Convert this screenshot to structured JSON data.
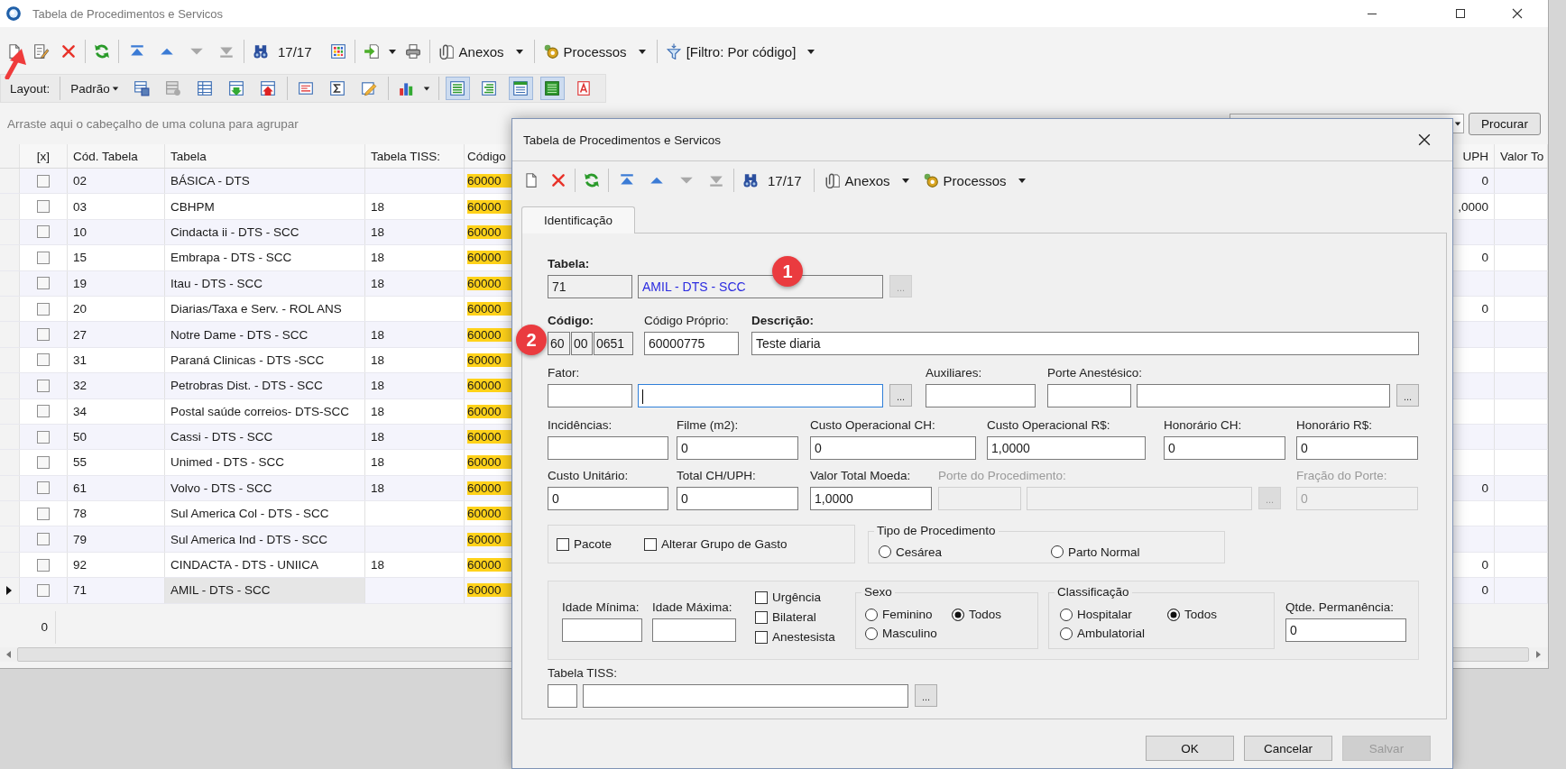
{
  "window": {
    "title": "Tabela de Procedimentos e Servicos"
  },
  "toolbar": {
    "nav": [
      {
        "disabled": false
      },
      {
        "disabled": false
      },
      {
        "disabled": true
      },
      {
        "disabled": true
      }
    ],
    "record_counter": "17/17",
    "attachments": "Anexos",
    "processes": "Processos",
    "filter": "[Filtro: Por código]"
  },
  "layout_bar": {
    "label": "Layout:",
    "preset": "Padrão",
    "views": [
      {
        "selected": true
      },
      {
        "selected": false
      },
      {
        "selected": true
      },
      {
        "selected": true
      },
      {
        "selected": false
      }
    ]
  },
  "group_panel": {
    "hint": "Arraste aqui o cabeçalho de uma coluna para agrupar",
    "search_button": "Procurar"
  },
  "grid": {
    "columns": [
      "[x]",
      "Cód. Tabela",
      "Tabela",
      "Tabela TISS:",
      "Código",
      "UPH",
      "Valor To"
    ],
    "rows": [
      {
        "checked": false,
        "selected": false,
        "code": "02",
        "table": "BÁSICA - DTS",
        "codigo": "60000",
        "uph": "0"
      },
      {
        "checked": false,
        "selected": false,
        "code": "03",
        "table": "CBHPM",
        "tiss": "18",
        "codigo": "60000",
        "uph": ",0000"
      },
      {
        "checked": false,
        "selected": false,
        "code": "10",
        "table": "Cindacta ii - DTS - SCC",
        "tiss": "18",
        "codigo": "60000"
      },
      {
        "checked": false,
        "selected": false,
        "code": "15",
        "table": "Embrapa - DTS - SCC",
        "tiss": "18",
        "codigo": "60000",
        "uph": "0"
      },
      {
        "checked": false,
        "selected": false,
        "code": "19",
        "table": "Itau - DTS - SCC",
        "tiss": "18",
        "codigo": "60000"
      },
      {
        "checked": false,
        "selected": false,
        "code": "20",
        "table": "Diarias/Taxa e Serv. - ROL ANS",
        "codigo": "60000",
        "uph": "0"
      },
      {
        "checked": false,
        "selected": false,
        "code": "27",
        "table": "Notre Dame - DTS - SCC",
        "tiss": "18",
        "codigo": "60000"
      },
      {
        "checked": false,
        "selected": false,
        "code": "31",
        "table": "Paraná Clinicas - DTS -SCC",
        "tiss": "18",
        "codigo": "60000"
      },
      {
        "checked": false,
        "selected": false,
        "code": "32",
        "table": "Petrobras Dist. - DTS - SCC",
        "tiss": "18",
        "codigo": "60000"
      },
      {
        "checked": false,
        "selected": false,
        "code": "34",
        "table": "Postal saúde correios- DTS-SCC",
        "tiss": "18",
        "codigo": "60000"
      },
      {
        "checked": false,
        "selected": false,
        "code": "50",
        "table": "Cassi - DTS - SCC",
        "tiss": "18",
        "codigo": "60000"
      },
      {
        "checked": false,
        "selected": false,
        "code": "55",
        "table": "Unimed - DTS - SCC",
        "tiss": "18",
        "codigo": "60000"
      },
      {
        "checked": false,
        "selected": false,
        "code": "61",
        "table": "Volvo - DTS - SCC",
        "tiss": "18",
        "codigo": "60000",
        "uph": "0"
      },
      {
        "checked": false,
        "selected": false,
        "code": "78",
        "table": "Sul America Col - DTS - SCC",
        "codigo": "60000"
      },
      {
        "checked": false,
        "selected": false,
        "code": "79",
        "table": "Sul America Ind - DTS - SCC",
        "codigo": "60000"
      },
      {
        "checked": false,
        "selected": false,
        "code": "92",
        "table": "CINDACTA - DTS - UNIICA",
        "tiss": "18",
        "codigo": "60000",
        "uph": "0"
      },
      {
        "checked": false,
        "selected": true,
        "code": "71",
        "table": "AMIL - DTS - SCC",
        "codigo": "60000",
        "uph": "0"
      }
    ],
    "footer": "0"
  },
  "dialog": {
    "title": "Tabela de Procedimentos e Servicos",
    "toolbar": {
      "nav": [
        {
          "disabled": false
        },
        {
          "disabled": false
        },
        {
          "disabled": true
        },
        {
          "disabled": true
        }
      ],
      "record_counter": "17/17",
      "attachments": "Anexos",
      "processes": "Processos"
    },
    "tabs": [
      {
        "label": "Identificação",
        "selected": true
      }
    ],
    "fields": [
      {
        "kind": "lookup",
        "label": "Tabela:",
        "required": true,
        "readonly": true,
        "disabled": false,
        "focused": false,
        "code": "71",
        "name": "AMIL - DTS - SCC",
        "button": "..."
      },
      {
        "kind": "segments",
        "label": "Código:",
        "required": true,
        "readonly": true,
        "disabled": false,
        "focused": false,
        "values": [
          "60",
          "00",
          "0651"
        ]
      },
      {
        "kind": "field",
        "label": "Código Próprio:",
        "required": false,
        "readonly": false,
        "disabled": false,
        "focused": false,
        "value": "60000775"
      },
      {
        "kind": "field",
        "label": "Descrição:",
        "required": true,
        "readonly": false,
        "disabled": false,
        "focused": false,
        "value": "Teste diaria"
      },
      {
        "kind": "lookup",
        "label": "Fator:",
        "required": false,
        "readonly": false,
        "disabled": false,
        "focused": true,
        "button": "..."
      },
      {
        "kind": "field",
        "label": "Auxiliares:",
        "required": false,
        "readonly": false,
        "disabled": false,
        "focused": false
      },
      {
        "kind": "lookup",
        "label": "Porte Anestésico:",
        "required": false,
        "readonly": false,
        "disabled": false,
        "focused": false,
        "button": "..."
      },
      {
        "kind": "field",
        "label": "Incidências:",
        "required": false,
        "readonly": false,
        "disabled": false,
        "focused": false
      },
      {
        "kind": "field",
        "label": "Filme (m2):",
        "required": false,
        "readonly": false,
        "disabled": false,
        "focused": false,
        "value": "0"
      },
      {
        "kind": "field",
        "label": "Custo Operacional CH:",
        "required": false,
        "readonly": false,
        "disabled": false,
        "focused": false,
        "value": "0"
      },
      {
        "kind": "field",
        "label": "Custo Operacional R$:",
        "required": false,
        "readonly": false,
        "disabled": false,
        "focused": false,
        "value": "1,0000"
      },
      {
        "kind": "field",
        "label": "Honorário CH:",
        "required": false,
        "readonly": false,
        "disabled": false,
        "focused": false,
        "value": "0"
      },
      {
        "kind": "field",
        "label": "Honorário R$:",
        "required": false,
        "readonly": false,
        "disabled": false,
        "focused": false,
        "value": "0"
      },
      {
        "kind": "field",
        "label": "Custo Unitário:",
        "required": false,
        "readonly": false,
        "disabled": false,
        "focused": false,
        "value": "0"
      },
      {
        "kind": "field",
        "label": "Total CH/UPH:",
        "required": false,
        "readonly": false,
        "disabled": false,
        "focused": false,
        "value": "0"
      },
      {
        "kind": "field",
        "label": "Valor Total Moeda:",
        "required": false,
        "readonly": false,
        "disabled": false,
        "focused": false,
        "value": "1,0000"
      },
      {
        "kind": "lookup",
        "label": "Porte do Procedimento:",
        "required": false,
        "readonly": false,
        "disabled": true,
        "focused": false,
        "button": "..."
      },
      {
        "kind": "field",
        "label": "Fração do Porte:",
        "required": false,
        "readonly": false,
        "disabled": true,
        "focused": false,
        "value": "0"
      }
    ],
    "options": {
      "checkboxes": [
        {
          "label": "Pacote",
          "checked": false
        },
        {
          "label": "Alterar Grupo de Gasto",
          "checked": false
        }
      ],
      "procedure_type": {
        "legend": "Tipo de Procedimento",
        "options": [
          {
            "label": "Cesárea",
            "selected": false
          },
          {
            "label": "Parto Normal",
            "selected": false
          }
        ]
      }
    },
    "limits": {
      "min_age": {
        "label": "Idade Mínima:"
      },
      "max_age": {
        "label": "Idade Máxima:"
      },
      "flags": [
        {
          "label": "Urgência",
          "checked": false
        },
        {
          "label": "Bilateral",
          "checked": false
        },
        {
          "label": "Anestesista",
          "checked": false
        }
      ],
      "sex": {
        "legend": "Sexo",
        "options": [
          {
            "label": "Feminino",
            "selected": false
          },
          {
            "label": "Todos",
            "selected": true
          },
          {
            "label": "Masculino",
            "selected": false
          }
        ]
      },
      "classification": {
        "legend": "Classificação",
        "options": [
          {
            "label": "Hospitalar",
            "selected": false
          },
          {
            "label": "Todos",
            "selected": true
          },
          {
            "label": "Ambulatorial",
            "selected": false
          }
        ]
      },
      "stay": {
        "label": "Qtde. Permanência:",
        "value": "0"
      }
    },
    "tiss": {
      "label": "Tabela TISS:",
      "button": "..."
    },
    "buttons": [
      {
        "label": "OK",
        "disabled": false
      },
      {
        "label": "Cancelar",
        "disabled": false
      },
      {
        "label": "Salvar",
        "disabled": true
      }
    ]
  },
  "annotations": {
    "badges": [
      "1",
      "2"
    ]
  }
}
